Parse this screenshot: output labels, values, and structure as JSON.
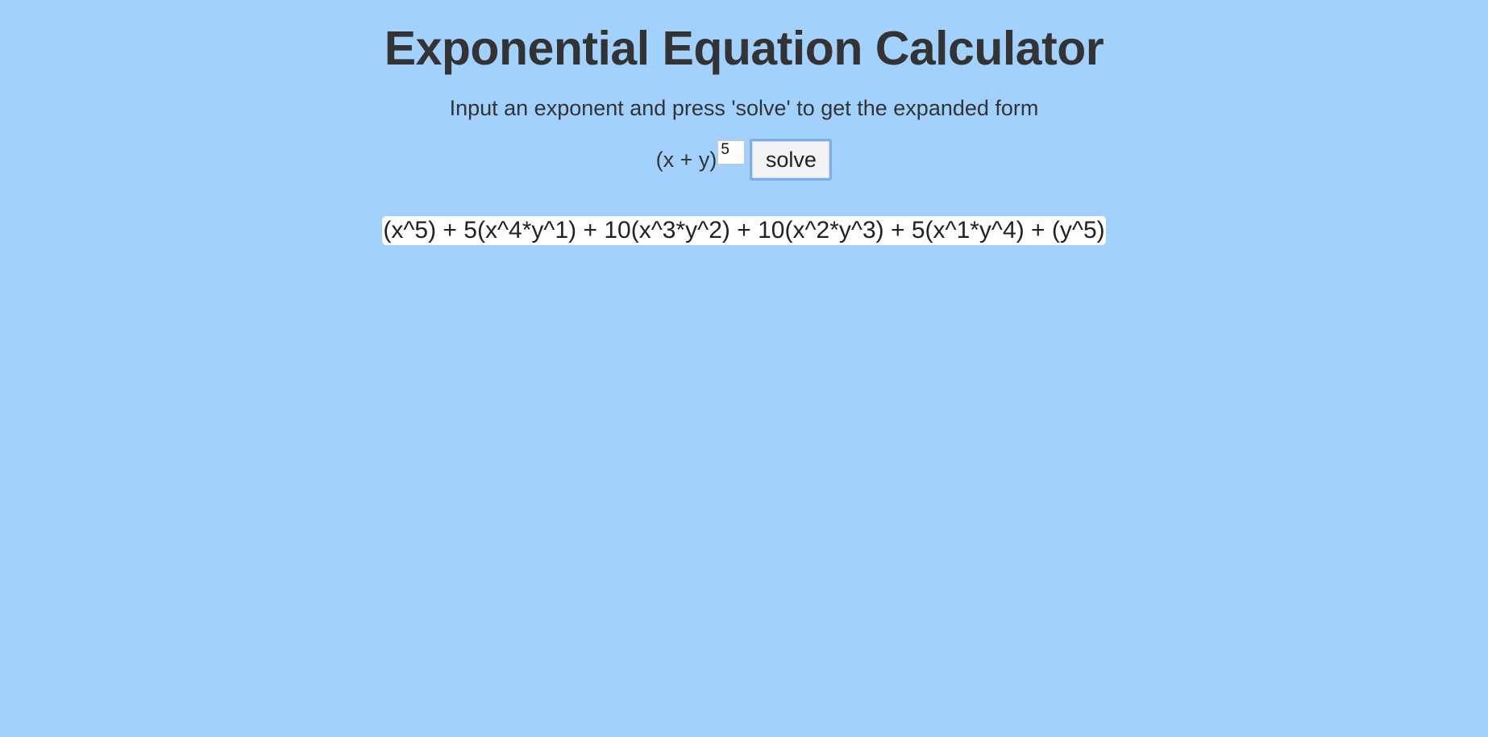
{
  "header": {
    "title": "Exponential Equation Calculator",
    "subtitle": "Input an exponent and press 'solve' to get the expanded form"
  },
  "form": {
    "base_label": "(x + y)",
    "exponent_value": "5",
    "solve_label": "solve"
  },
  "result": {
    "expansion": "(x^5) + 5(x^4*y^1) + 10(x^3*y^2) + 10(x^2*y^3) + 5(x^1*y^4) + (y^5)"
  },
  "colors": {
    "background": "#a3d1fd",
    "text": "#333333",
    "button_focus_border": "#7aaeee",
    "result_background": "#ffffff"
  }
}
